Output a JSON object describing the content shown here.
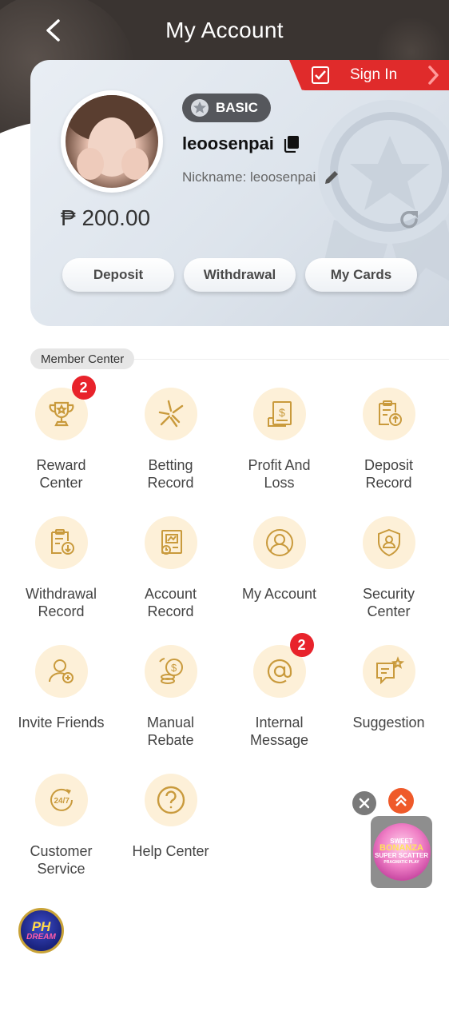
{
  "header": {
    "title": "My Account"
  },
  "signin": {
    "label": "Sign In"
  },
  "profile": {
    "level": "BASIC",
    "username": "leoosenpai",
    "nickname": "Nickname: leoosenpai",
    "balance": "₱ 200.00"
  },
  "actions": {
    "deposit": "Deposit",
    "withdrawal": "Withdrawal",
    "my_cards": "My Cards"
  },
  "member_center": {
    "title": "Member Center",
    "items": [
      {
        "label": "Reward\nCenter",
        "icon": "trophy-icon",
        "badge": "2"
      },
      {
        "label": "Betting\nRecord",
        "icon": "betting-record-icon"
      },
      {
        "label": "Profit And\nLoss",
        "icon": "profit-loss-icon"
      },
      {
        "label": "Deposit\nRecord",
        "icon": "deposit-record-icon"
      },
      {
        "label": "Withdrawal\nRecord",
        "icon": "withdrawal-record-icon"
      },
      {
        "label": "Account\nRecord",
        "icon": "account-record-icon"
      },
      {
        "label": "My Account",
        "icon": "user-icon"
      },
      {
        "label": "Security\nCenter",
        "icon": "shield-icon"
      },
      {
        "label": "Invite Friends",
        "icon": "invite-friends-icon"
      },
      {
        "label": "Manual\nRebate",
        "icon": "rebate-coins-icon"
      },
      {
        "label": "Internal\nMessage",
        "icon": "at-sign-icon",
        "badge": "2"
      },
      {
        "label": "Suggestion",
        "icon": "suggestion-icon"
      },
      {
        "label": "Customer\nService",
        "icon": "customer-service-24-7-icon"
      },
      {
        "label": "Help Center",
        "icon": "help-icon"
      }
    ]
  },
  "floating_game": {
    "line1": "SWEET",
    "line2": "BONANZA",
    "line3": "SUPER SCATTER",
    "line4": "PRAGMATIC PLAY"
  },
  "logo": {
    "line1": "PH",
    "line2": "DREAM"
  },
  "colors": {
    "header_bg": "#3a3431",
    "signin_red": "#e02b2b",
    "icon_circle": "#fdf0d8",
    "icon_stroke": "#c99a3c",
    "notification_red": "#e8232b"
  }
}
